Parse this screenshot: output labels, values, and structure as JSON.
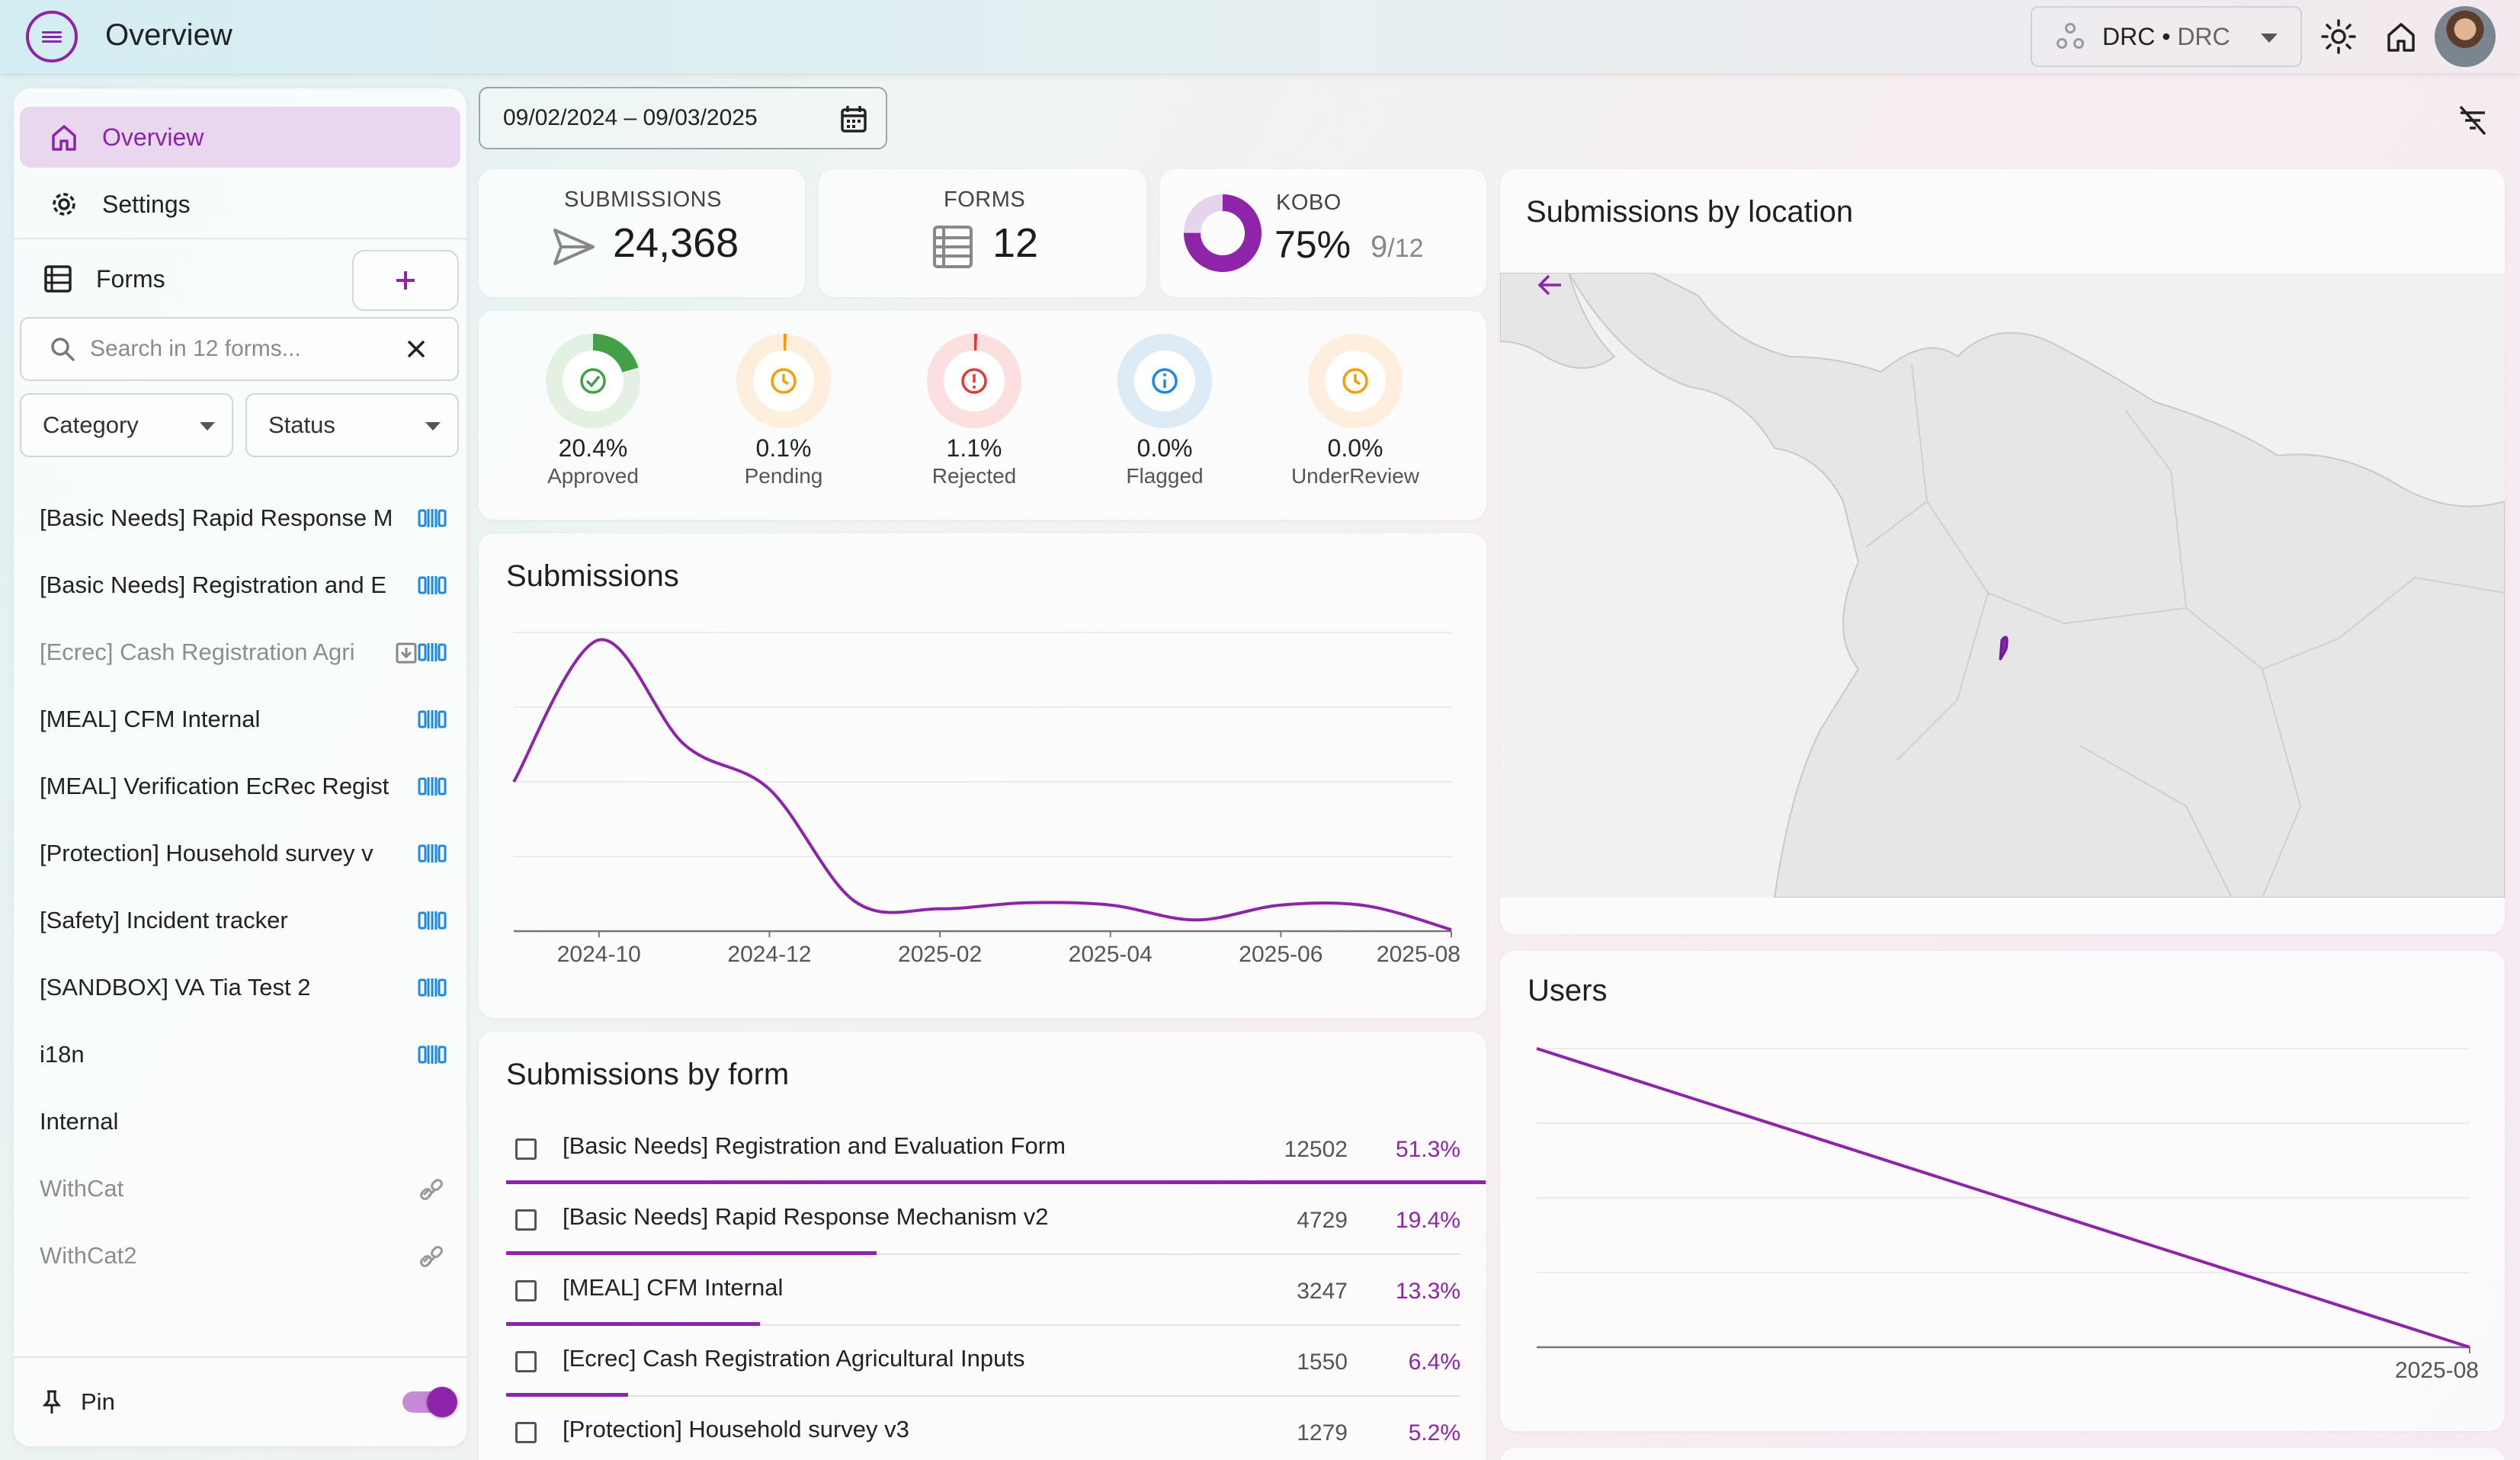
{
  "header": {
    "title": "Overview",
    "org_name": "DRC",
    "org_separator": " • ",
    "org_sub": "DRC"
  },
  "sidebar": {
    "overview_label": "Overview",
    "settings_label": "Settings",
    "forms_label": "Forms",
    "search_placeholder": "Search in 12 forms...",
    "category_label": "Category",
    "status_label": "Status",
    "forms": [
      {
        "label": "[Basic Needs] Rapid Response M",
        "state": "synced"
      },
      {
        "label": "[Basic Needs] Registration and E",
        "state": "synced"
      },
      {
        "label": "[Ecrec] Cash Registration Agri",
        "state": "archived"
      },
      {
        "label": "[MEAL] CFM Internal",
        "state": "synced"
      },
      {
        "label": "[MEAL] Verification EcRec Regist",
        "state": "synced"
      },
      {
        "label": "[Protection] Household survey v",
        "state": "synced"
      },
      {
        "label": "[Safety] Incident tracker",
        "state": "synced"
      },
      {
        "label": "[SANDBOX] VA Tia Test 2",
        "state": "synced"
      },
      {
        "label": "i18n",
        "state": "synced"
      },
      {
        "label": "Internal",
        "state": "none"
      },
      {
        "label": "WithCat",
        "state": "unlinked"
      },
      {
        "label": "WithCat2",
        "state": "unlinked"
      }
    ],
    "pin_label": "Pin",
    "pin_enabled": true
  },
  "filters": {
    "date_range": "09/02/2024 – 09/03/2025"
  },
  "stats": {
    "submissions_label": "SUBMISSIONS",
    "submissions_value": "24,368",
    "forms_label": "FORMS",
    "forms_value": "12",
    "kobo_label": "KOBO",
    "kobo_value": "75%",
    "kobo_ratio_num": "9",
    "kobo_ratio_den": "/12",
    "kobo_fraction": 0.75
  },
  "statuses": [
    {
      "pct": "20.4%",
      "name": "Approved",
      "color": "#43a047",
      "bg": "#e3f1e3",
      "icon": "check-circle-icon",
      "fraction": 0.204
    },
    {
      "pct": "0.1%",
      "name": "Pending",
      "color": "#f59e0b",
      "bg": "#fdeedd",
      "icon": "clock-icon",
      "fraction": 0.001
    },
    {
      "pct": "1.1%",
      "name": "Rejected",
      "color": "#e53935",
      "bg": "#fbe0df",
      "icon": "error-icon",
      "fraction": 0.011
    },
    {
      "pct": "0.0%",
      "name": "Flagged",
      "color": "#1e88e5",
      "bg": "#dcebf6",
      "icon": "info-icon",
      "fraction": 0
    },
    {
      "pct": "0.0%",
      "name": "UnderReview",
      "color": "#f59e0b",
      "bg": "#fdeedd",
      "icon": "clock-icon",
      "fraction": 0
    }
  ],
  "submissions_chart": {
    "title": "Submissions"
  },
  "by_form": {
    "title": "Submissions by form",
    "rows": [
      {
        "name": "[Basic Needs] Registration and Evaluation Form",
        "count": "12502",
        "pct": "51.3%",
        "fraction": 0.513
      },
      {
        "name": "[Basic Needs] Rapid Response Mechanism v2",
        "count": "4729",
        "pct": "19.4%",
        "fraction": 0.194
      },
      {
        "name": "[MEAL] CFM Internal",
        "count": "3247",
        "pct": "13.3%",
        "fraction": 0.133
      },
      {
        "name": "[Ecrec] Cash Registration Agricultural Inputs",
        "count": "1550",
        "pct": "6.4%",
        "fraction": 0.064
      },
      {
        "name": "[Protection] Household survey v3",
        "count": "1279",
        "pct": "5.2%",
        "fraction": 0.052
      }
    ]
  },
  "map": {
    "title": "Submissions by location"
  },
  "users": {
    "title": "Users"
  },
  "chart_data": [
    {
      "type": "line",
      "title": "Submissions",
      "x": [
        "2024-09",
        "2024-10",
        "2024-11",
        "2024-12",
        "2025-01",
        "2025-02",
        "2025-03",
        "2025-04",
        "2025-05",
        "2025-06",
        "2025-07",
        "2025-08"
      ],
      "xticks": [
        "2024-10",
        "2024-12",
        "2025-02",
        "2025-04",
        "2025-06",
        "2025-08"
      ],
      "values": [
        2000,
        3900,
        2500,
        1900,
        400,
        300,
        380,
        350,
        150,
        350,
        340,
        20
      ],
      "ylim": [
        0,
        4000
      ],
      "grid": true,
      "color": "#8e24aa"
    },
    {
      "type": "line",
      "title": "Users",
      "x": [
        "2024-09",
        "2025-08"
      ],
      "xticks": [
        "2025-08"
      ],
      "values": [
        4,
        0
      ],
      "ylim": [
        0,
        4
      ],
      "grid": true,
      "color": "#8e24aa"
    }
  ],
  "colors": {
    "accent": "#8e24aa",
    "sync": "#1e88e5"
  }
}
